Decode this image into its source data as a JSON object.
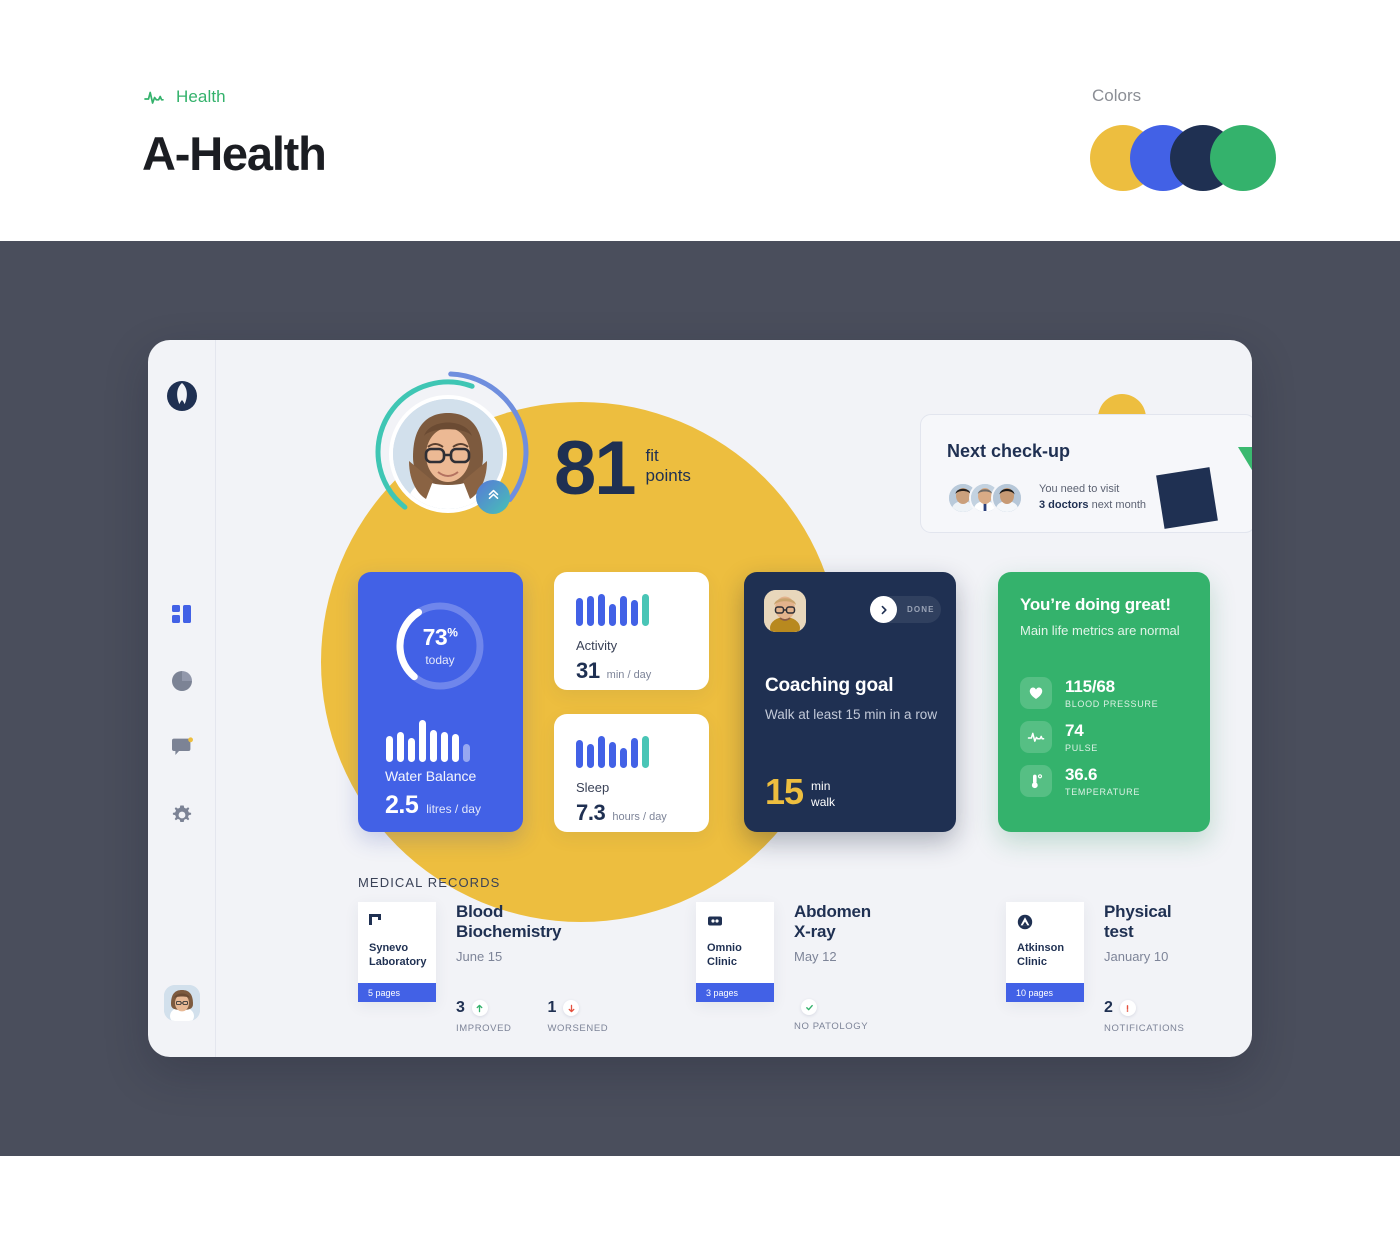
{
  "header": {
    "brand_tag": "Health",
    "brand_tag_icon": "pulse-icon",
    "title": "A-Health",
    "colors_label": "Colors",
    "swatches": [
      "#edbe3f",
      "#4261e6",
      "#1f3052",
      "#34b26c"
    ]
  },
  "sidebar": {
    "logo_icon": "a-health-logo-icon",
    "items": [
      {
        "icon": "dashboard-icon",
        "name": "dashboard",
        "active": true
      },
      {
        "icon": "pie-chart-icon",
        "name": "statistics",
        "active": false
      },
      {
        "icon": "chat-icon",
        "name": "messages",
        "active": false,
        "badge": true
      },
      {
        "icon": "gear-icon",
        "name": "settings",
        "active": false
      }
    ],
    "avatar_alt": "user-avatar"
  },
  "hero": {
    "avatar_alt": "profile-photo",
    "badge_icon": "double-chevron-up-icon",
    "score": "81",
    "unit_line1": "fit",
    "unit_line2": "points"
  },
  "checkup": {
    "title": "Next check-up",
    "doctors_count": 3,
    "text_before": "You need to visit",
    "text_bold": "3 doctors",
    "text_after": " next month"
  },
  "cards": {
    "water": {
      "ring_value": "73",
      "ring_unit": "%",
      "ring_sub": "today",
      "label": "Water Balance",
      "value": "2.5",
      "unit": "litres / day"
    },
    "activity": {
      "label": "Activity",
      "value": "31",
      "unit": "min / day"
    },
    "sleep": {
      "label": "Sleep",
      "value": "7.3",
      "unit": "hours / day"
    },
    "coach": {
      "avatar_alt": "coach-photo",
      "done_label": "DONE",
      "done_icon": "chevron-right-icon",
      "title": "Coaching goal",
      "description": "Walk at least 15 min in a row",
      "value": "15",
      "unit_line1": "min",
      "unit_line2": "walk"
    },
    "green": {
      "title": "You’re doing great!",
      "subtitle": "Main life metrics are normal",
      "vitals": [
        {
          "icon": "heart-icon",
          "value": "115/68",
          "label": "BLOOD PRESSURE"
        },
        {
          "icon": "pulse-icon",
          "value": "74",
          "label": "PULSE"
        },
        {
          "icon": "thermometer-icon",
          "value": "36.6",
          "label": "TEMPERATURE"
        }
      ]
    }
  },
  "records": {
    "title": "MEDICAL RECORDS",
    "items": [
      {
        "clinic": "Synevo Laboratory",
        "clinic_icon": "synevo-logo-icon",
        "pages": "5 pages",
        "name": "Blood Biochemistry",
        "date": "June 15",
        "stats": [
          {
            "num": "3",
            "chip": "arrow-up-icon",
            "chip_color": "#34b26c",
            "label": "IMPROVED"
          },
          {
            "num": "1",
            "chip": "arrow-down-icon",
            "chip_color": "#e5503e",
            "label": "WORSENED"
          }
        ]
      },
      {
        "clinic": "Omnio Clinic",
        "clinic_icon": "omnio-logo-icon",
        "pages": "3 pages",
        "name": "Abdomen X-ray",
        "date": "May 12",
        "stats": [
          {
            "num": "",
            "chip": "check-icon",
            "chip_color": "#34b26c",
            "label": "NO PATOLOGY"
          }
        ]
      },
      {
        "clinic": "Atkinson Clinic",
        "clinic_icon": "atkinson-logo-icon",
        "pages": "10 pages",
        "name": "Physical test",
        "date": "January 10",
        "stats": [
          {
            "num": "2",
            "chip": "exclamation-icon",
            "chip_color": "#e5503e",
            "label": "NOTIFICATIONS"
          }
        ]
      }
    ]
  },
  "chart_data": [
    {
      "type": "bar",
      "title": "Water Balance",
      "categories": [
        "1",
        "2",
        "3",
        "4",
        "5",
        "6",
        "7",
        "8"
      ],
      "values": [
        26,
        30,
        24,
        42,
        32,
        30,
        28,
        18
      ],
      "ylabel": "litres / day",
      "annotation": "2.5 litres / day, ring 73% today"
    },
    {
      "type": "bar",
      "title": "Activity",
      "categories": [
        "1",
        "2",
        "3",
        "4",
        "5",
        "6",
        "7"
      ],
      "values": [
        28,
        30,
        32,
        22,
        30,
        26,
        32
      ],
      "ylabel": "min / day",
      "annotation": "31 min / day"
    },
    {
      "type": "bar",
      "title": "Sleep",
      "categories": [
        "1",
        "2",
        "3",
        "4",
        "5",
        "6",
        "7"
      ],
      "values": [
        28,
        24,
        32,
        26,
        20,
        30,
        32
      ],
      "ylabel": "hours / day",
      "annotation": "7.3 hours / day"
    }
  ]
}
